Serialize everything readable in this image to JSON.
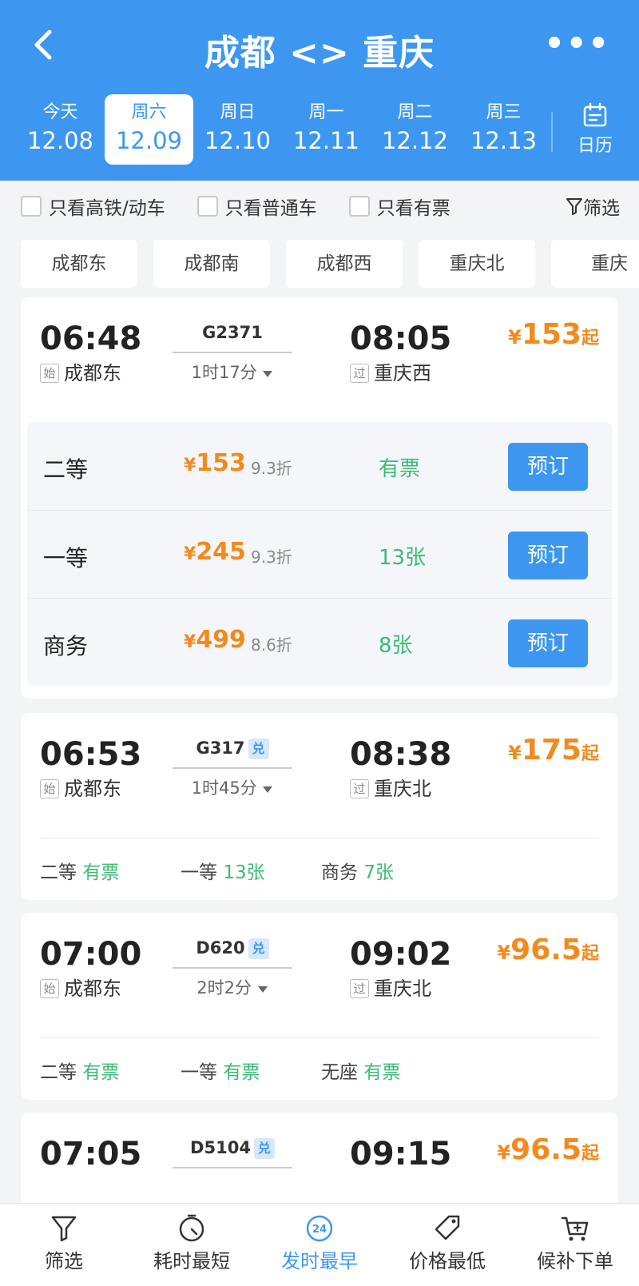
{
  "header": {
    "title": "成都 <> 重庆",
    "back_icon": "chevron-left-icon",
    "more_label": "•••"
  },
  "dates": [
    {
      "weekday": "今天",
      "date": "12.08"
    },
    {
      "weekday": "周六",
      "date": "12.09",
      "selected": true
    },
    {
      "weekday": "周日",
      "date": "12.10"
    },
    {
      "weekday": "周一",
      "date": "12.11"
    },
    {
      "weekday": "周二",
      "date": "12.12"
    },
    {
      "weekday": "周三",
      "date": "12.13"
    }
  ],
  "calendar_label": "日历",
  "filters": {
    "high_speed": "只看高铁/动车",
    "normal": "只看普通车",
    "available": "只看有票",
    "filter": "筛选"
  },
  "stations": [
    "成都东",
    "成都南",
    "成都西",
    "重庆北",
    "重庆"
  ],
  "trains": [
    {
      "dep_time": "06:48",
      "dep_tag": "始",
      "dep_station": "成都东",
      "train_no": "G2371",
      "duration": "1时17分",
      "arr_time": "08:05",
      "arr_tag": "过",
      "arr_station": "重庆西",
      "currency": "¥",
      "price": "153",
      "price_suffix": "起",
      "seats": [
        {
          "name": "二等",
          "currency": "¥",
          "price": "153",
          "discount": "9.3折",
          "availability": "有票",
          "button": "预订"
        },
        {
          "name": "一等",
          "currency": "¥",
          "price": "245",
          "discount": "9.3折",
          "availability": "13张",
          "button": "预订"
        },
        {
          "name": "商务",
          "currency": "¥",
          "price": "499",
          "discount": "8.6折",
          "availability": "8张",
          "button": "预订"
        }
      ]
    },
    {
      "dep_time": "06:53",
      "dep_tag": "始",
      "dep_station": "成都东",
      "train_no": "G317",
      "exchange": "兑",
      "duration": "1时45分",
      "arr_time": "08:38",
      "arr_tag": "过",
      "arr_station": "重庆北",
      "currency": "¥",
      "price": "175",
      "price_suffix": "起",
      "summary": [
        {
          "name": "二等",
          "availability": "有票"
        },
        {
          "name": "一等",
          "availability": "13张"
        },
        {
          "name": "商务",
          "availability": "7张"
        }
      ]
    },
    {
      "dep_time": "07:00",
      "dep_tag": "始",
      "dep_station": "成都东",
      "train_no": "D620",
      "exchange": "兑",
      "duration": "2时2分",
      "arr_time": "09:02",
      "arr_tag": "过",
      "arr_station": "重庆北",
      "currency": "¥",
      "price": "96.5",
      "price_suffix": "起",
      "summary": [
        {
          "name": "二等",
          "availability": "有票"
        },
        {
          "name": "一等",
          "availability": "有票"
        },
        {
          "name": "无座",
          "availability": "有票"
        }
      ]
    },
    {
      "dep_time": "07:05",
      "train_no": "D5104",
      "exchange": "兑",
      "arr_time": "09:15",
      "currency": "¥",
      "price": "96.5",
      "price_suffix": "起"
    }
  ],
  "bottom_tabs": [
    {
      "label": "筛选",
      "icon": "filter-icon"
    },
    {
      "label": "耗时最短",
      "icon": "timer-icon"
    },
    {
      "label": "发时最早",
      "icon": "clock-24-icon",
      "active": true,
      "icon_text": "24"
    },
    {
      "label": "价格最低",
      "icon": "price-tag-icon"
    },
    {
      "label": "候补下单",
      "icon": "cart-plus-icon"
    }
  ],
  "colors": {
    "primary": "#3d97f0",
    "price": "#f28a1e",
    "available": "#3dba74"
  }
}
